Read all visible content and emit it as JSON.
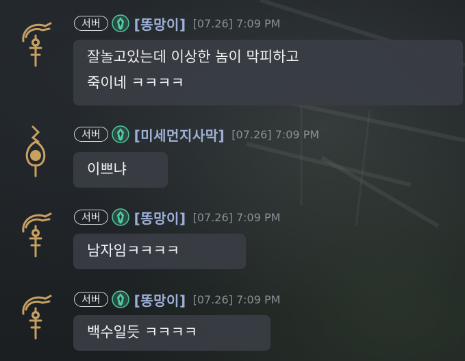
{
  "messages": [
    {
      "badge": "서버",
      "username": "[똥망이]",
      "timestamp": "[07.26] 7:09 PM",
      "lines": [
        "잘놀고있는데 이상한 놈이 막피하고",
        "죽이네 ㅋㅋㅋㅋ"
      ],
      "avatar": "feather-staff-icon"
    },
    {
      "badge": "서버",
      "username": "[미세먼지사막]",
      "timestamp": "[07.26] 7:09 PM",
      "lines": [
        "이쁘냐"
      ],
      "avatar": "orb-pendant-icon"
    },
    {
      "badge": "서버",
      "username": "[똥망이]",
      "timestamp": "[07.26] 7:09 PM",
      "lines": [
        "남자임ㅋㅋㅋㅋ"
      ],
      "avatar": "feather-staff-icon"
    },
    {
      "badge": "서버",
      "username": "[똥망이]",
      "timestamp": "[07.26] 7:09 PM",
      "lines": [
        "백수일듯 ㅋㅋㅋㅋ"
      ],
      "avatar": "feather-staff-icon"
    }
  ],
  "colors": {
    "username": "#9fb0d8",
    "timestamp": "#8c9096",
    "bubble": "#3a3d44",
    "avatar_gold": "#c8a062",
    "role_icon_green": "#4fc9a0"
  }
}
